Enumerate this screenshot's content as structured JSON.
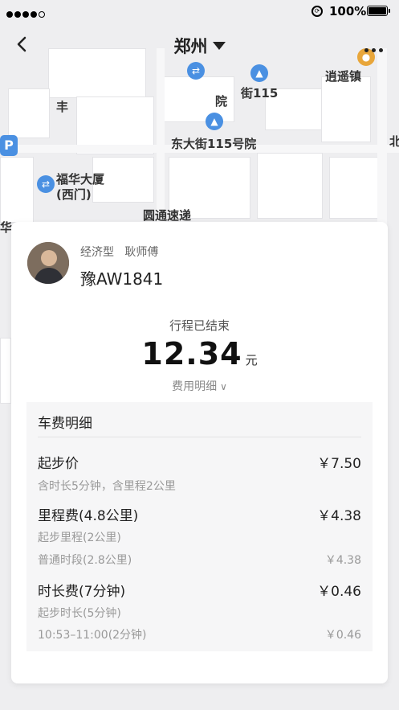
{
  "status_bar": {
    "battery": "100%"
  },
  "nav": {
    "city": "郑州"
  },
  "map": {
    "labels": {
      "l1": "丰",
      "l2": "院",
      "l3": "东大街115号院",
      "l4": "街115",
      "l5": "逍遥镇",
      "l6": "福华大厦",
      "l7": "(西门)",
      "l8": "圆通速递",
      "l9": "北",
      "l10": "华"
    }
  },
  "driver": {
    "type": "经济型",
    "name": "耿师傅",
    "plate": "豫AW1841"
  },
  "trip": {
    "status": "行程已结束",
    "amount": "12.34",
    "unit": "元",
    "detail_toggle": "费用明细"
  },
  "fee_detail": {
    "title": "车费明细",
    "items": [
      {
        "label": "起步价",
        "value": "￥7.50",
        "subs": [
          {
            "label": "含时长5分钟，含里程2公里",
            "value": ""
          }
        ]
      },
      {
        "label": "里程费(4.8公里)",
        "value": "￥4.38",
        "subs": [
          {
            "label": "起步里程(2公里)",
            "value": ""
          },
          {
            "label": "普通时段(2.8公里)",
            "value": "￥4.38"
          }
        ]
      },
      {
        "label": "时长费(7分钟)",
        "value": "￥0.46",
        "subs": [
          {
            "label": "起步时长(5分钟)",
            "value": ""
          },
          {
            "label": "10:53–11:00(2分钟)",
            "value": "￥0.46"
          }
        ]
      }
    ]
  }
}
